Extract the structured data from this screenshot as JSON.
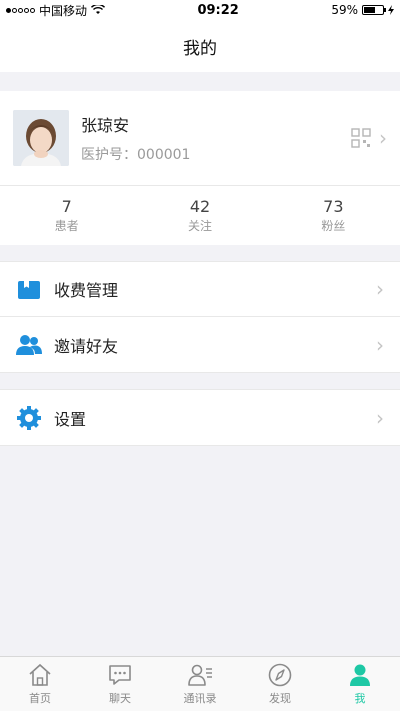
{
  "status_bar": {
    "carrier": "中国移动",
    "time": "09:22",
    "battery": "59%",
    "battery_level": 0.59
  },
  "nav": {
    "title": "我的"
  },
  "profile": {
    "name": "张琼安",
    "id_label": "医护号：000001"
  },
  "stats": [
    {
      "value": "7",
      "label": "患者"
    },
    {
      "value": "42",
      "label": "关注"
    },
    {
      "value": "73",
      "label": "粉丝"
    }
  ],
  "menu": {
    "fees": "收费管理",
    "invite": "邀请好友",
    "settings": "设置"
  },
  "tabs": [
    {
      "label": "首页",
      "icon": "home-icon"
    },
    {
      "label": "聊天",
      "icon": "chat-icon"
    },
    {
      "label": "通讯录",
      "icon": "contacts-icon"
    },
    {
      "label": "发现",
      "icon": "compass-icon"
    },
    {
      "label": "我",
      "icon": "person-icon",
      "active": true
    }
  ],
  "colors": {
    "accent": "#1ec8a5",
    "menu_icon_blue": "#1f8fdc"
  }
}
